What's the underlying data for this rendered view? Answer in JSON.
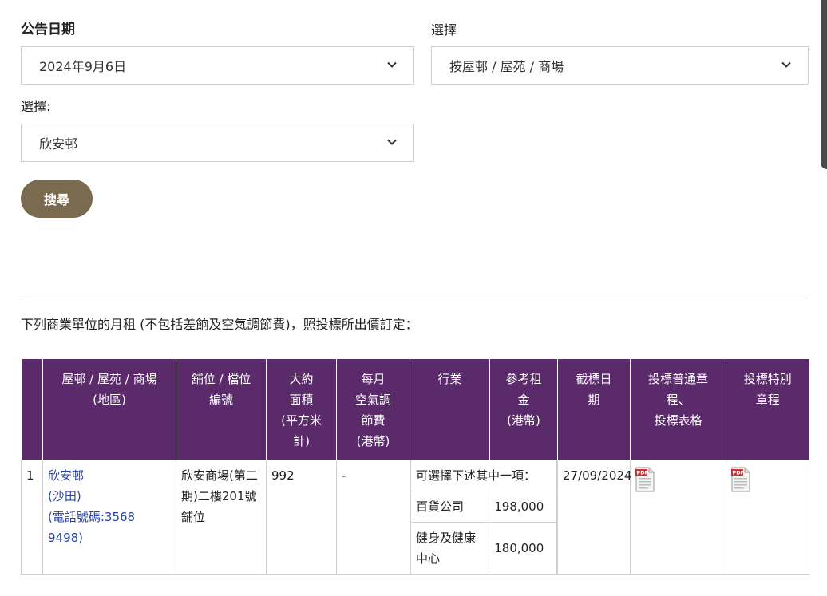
{
  "form": {
    "date_label": "公告日期",
    "date_value": "2024年9月6日",
    "select1_label": "選擇",
    "select1_value": "按屋邨 / 屋苑 / 商場",
    "select2_label": "選擇:",
    "select2_value": "欣安邨",
    "search_label": "搜尋"
  },
  "note": "下列商業單位的月租 (不包括差餉及空氣調節費)，照投標所出價訂定：",
  "table": {
    "headers": {
      "estate": [
        "屋邨 / 屋苑 / 商場",
        "(地區)"
      ],
      "shop": [
        "舖位 / 檔位",
        "編號"
      ],
      "area": [
        "大約",
        "面積",
        "(平方米",
        "計)"
      ],
      "ac_fee": [
        "每月",
        "空氣調",
        "節費",
        "(港幣)"
      ],
      "industry": [
        "行業"
      ],
      "rent": [
        "參考租",
        "金",
        "(港幣)"
      ],
      "deadline": [
        "截標日",
        "期"
      ],
      "general_terms": [
        "投標普通章",
        "程、",
        "投標表格"
      ],
      "special_terms": [
        "投標特別",
        "章程"
      ]
    },
    "row": {
      "index": "1",
      "estate_name": "欣安邨",
      "district": "(沙田)",
      "phone": "(電話號碼:3568 9498)",
      "shop": "欣安商場(第二期)二樓201號舖位",
      "area": "992",
      "ac_fee": "-",
      "industry_intro": "可選擇下述其中一項：",
      "options": [
        {
          "trade": "百貨公司",
          "rent": "198,000"
        },
        {
          "trade": "健身及健康中心",
          "rent": "180,000"
        }
      ],
      "deadline": "27/09/2024"
    }
  },
  "colors": {
    "header_bg": "#5a2a6a",
    "button_bg": "#7a6a4f",
    "link": "#2844a8"
  }
}
